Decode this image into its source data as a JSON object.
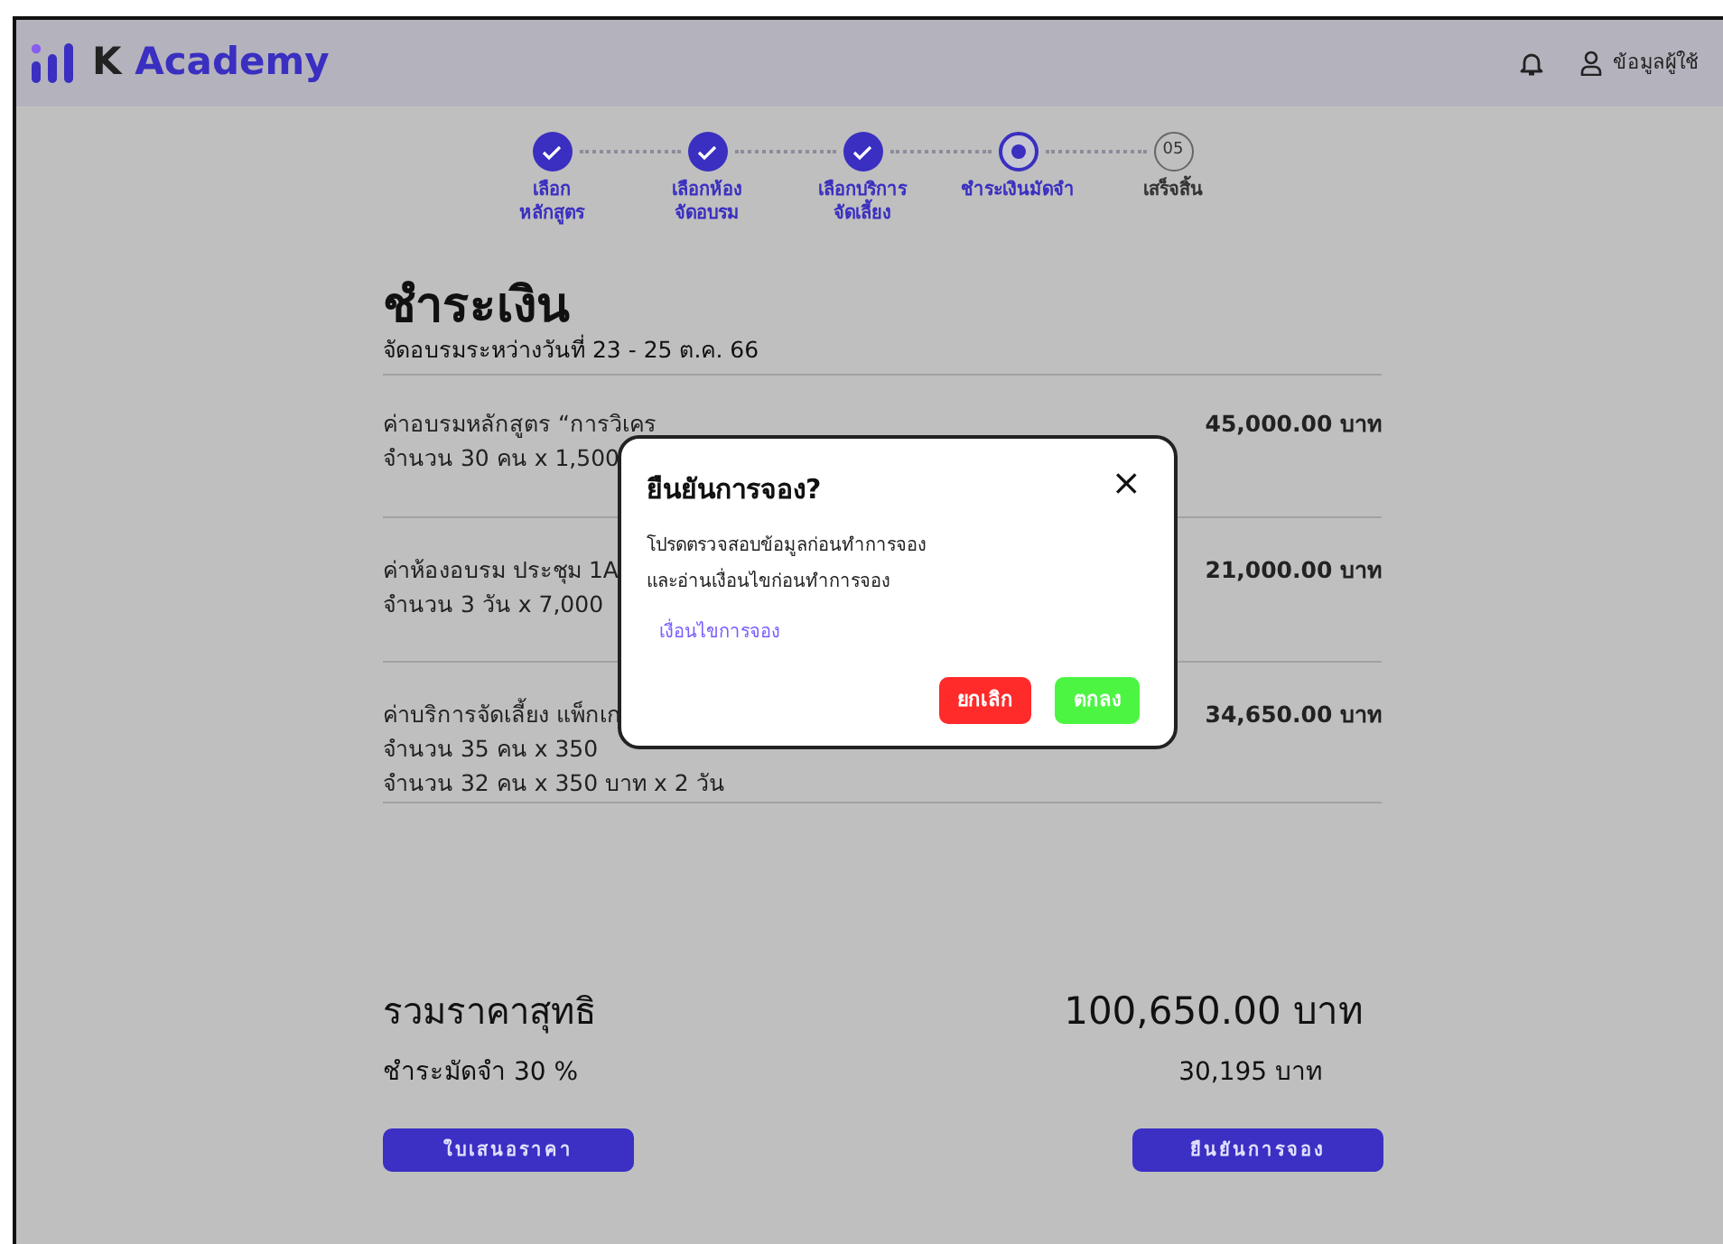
{
  "header": {
    "logo": "K Academy",
    "user": "ข้อมูลผู้ใช้"
  },
  "steps": [
    {
      "label": "เลือก\nหลักสูตร",
      "completed": true,
      "selected": false
    },
    {
      "label": "เลือกห้อง\nจัดอบรม",
      "completed": true,
      "selected": false
    },
    {
      "label": "เลือกบริการ\nจัดเลี้ยง",
      "completed": true,
      "selected": false
    },
    {
      "label": "ชำระเงินมัดจำ",
      "completed": false,
      "selected": true
    },
    {
      "label": "เสร็จสิ้น",
      "completed": false,
      "selected": false,
      "number": "05"
    }
  ],
  "title": "ชำระเงิน",
  "subtitle": "จัดอบรมระหว่างวันที่ 23 - 25 ต.ค.  66",
  "items": [
    {
      "lines": [
        "ค่าอบรมหลักสูตร “การวิเคร",
        "จำนวน 30 คน x 1,500"
      ],
      "price": "45,000.00 บาท"
    },
    {
      "lines": [
        "ค่าห้องอบรม ประชุม 1A",
        "จำนวน 3 วัน x 7,000"
      ],
      "price": "21,000.00 บาท"
    },
    {
      "lines": [
        "ค่าบริการจัดเลี้ยง แพ็กเก",
        "จำนวน 35 คน x 350",
        "จำนวน 32 คน x 350 บาท x 2 วัน"
      ],
      "price": "34,650.00 บาท"
    }
  ],
  "total": {
    "label": "รวมราคาสุทธิ",
    "value": "100,650.00 บาท",
    "deposit_label": "ชำระมัดจำ 30 %",
    "deposit_value": "30,195 บาท"
  },
  "buttons": [
    "ใบเสนอราคา",
    "ยืนยันการจอง"
  ],
  "modal": {
    "title": "ยืนยันการจอง?",
    "close": "×",
    "message": [
      "โปรดตรวจสอบข้อมูลก่อนทำการจอง",
      "และอ่านเงื่อนไขก่อนทำการจอง"
    ],
    "link": "เงื่อนไขการจอง",
    "cancel": "ยกเลิก",
    "ok": "ตกลง"
  }
}
